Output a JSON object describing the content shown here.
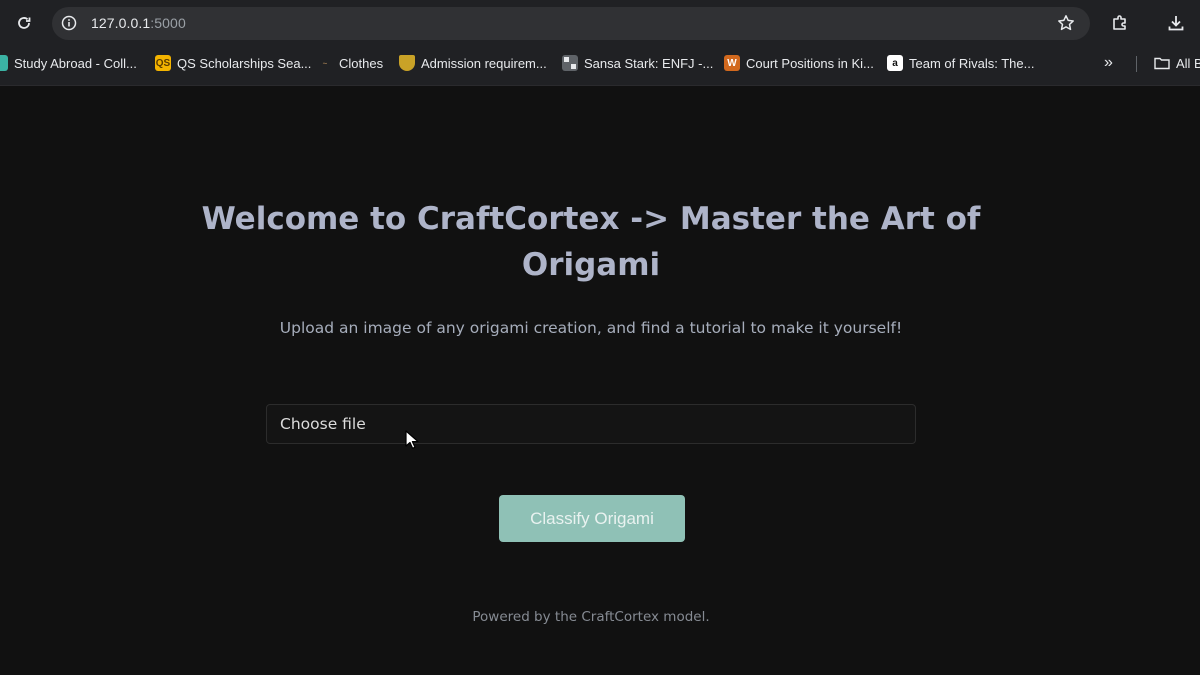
{
  "browser": {
    "url_host": "127.0.0.1",
    "url_port": ":5000",
    "bookmarks": [
      {
        "label": "Study Abroad - Coll...",
        "favicon": "dark-square-icon",
        "color": "#3bb3a4"
      },
      {
        "label": "QS Scholarships Sea...",
        "favicon": "qs-icon",
        "color": "#f4b400"
      },
      {
        "label": "Clothes",
        "favicon": "clothes-icon",
        "color": "#8a6d4a"
      },
      {
        "label": "Admission requirem...",
        "favicon": "crest-icon",
        "color": "#c9a227"
      },
      {
        "label": "Sansa Stark: ENFJ -...",
        "favicon": "grid-icon",
        "color": "#9aa0a6"
      },
      {
        "label": "Court Positions in Ki...",
        "favicon": "crown-icon",
        "color": "#d2691e"
      },
      {
        "label": "Team of Rivals: The...",
        "favicon": "amazon-icon",
        "color": "#ffffff"
      }
    ],
    "all_bookmarks_label": "All B"
  },
  "page": {
    "title": "Welcome to CraftCortex -> Master the Art of Origami",
    "subtitle": "Upload an image of any origami creation, and find a tutorial to make it yourself!",
    "file_input_label": "Choose file",
    "classify_button": "Classify Origami",
    "footer": "Powered by the CraftCortex model."
  },
  "colors": {
    "page_background": "#111111",
    "title": "#aeb4c9",
    "button_background": "#8fc1b6"
  }
}
